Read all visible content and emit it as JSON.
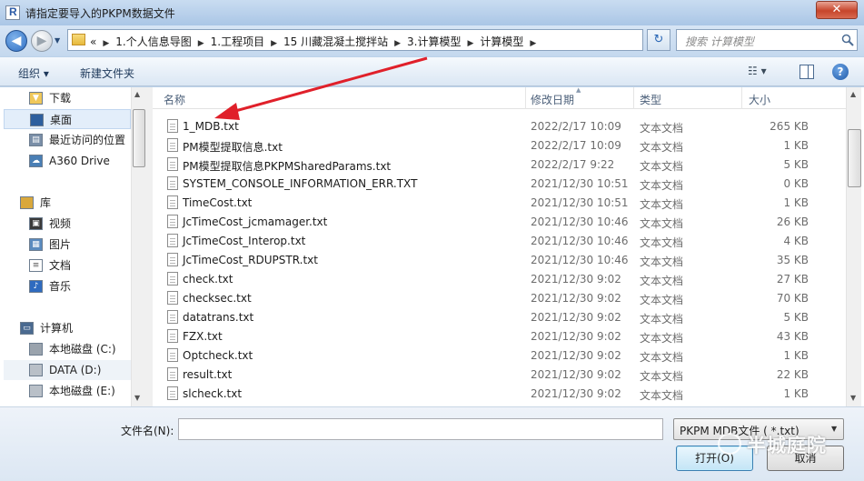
{
  "window": {
    "title": "请指定要导入的PKPM数据文件",
    "close_label": "✕"
  },
  "nav": {
    "back_glyph": "◀",
    "forward_glyph": "▶",
    "breadcrumbs": [
      "«",
      "1.个人信息导图",
      "1.工程项目",
      "15 川藏混凝土搅拌站",
      "3.计算模型",
      "计算模型"
    ],
    "refresh_glyph": "↻",
    "search_placeholder": "搜索 计算模型"
  },
  "toolbar": {
    "organize_label": "组织 ▾",
    "new_folder_label": "新建文件夹",
    "view_label": "☷ ▾",
    "help_label": "?"
  },
  "sidebar": {
    "items": [
      {
        "label": "下载",
        "icon": "download-folder-icon",
        "group": false
      },
      {
        "label": "桌面",
        "icon": "desktop-icon",
        "group": false,
        "selected": true
      },
      {
        "label": "最近访问的位置",
        "icon": "recent-places-icon",
        "group": false
      },
      {
        "label": "A360 Drive",
        "icon": "cloud-drive-icon",
        "group": false
      },
      {
        "label": "库",
        "icon": "library-icon",
        "group": true
      },
      {
        "label": "视频",
        "icon": "video-icon",
        "group": false
      },
      {
        "label": "图片",
        "icon": "picture-icon",
        "group": false
      },
      {
        "label": "文档",
        "icon": "document-icon",
        "group": false
      },
      {
        "label": "音乐",
        "icon": "music-icon",
        "group": false
      },
      {
        "label": "计算机",
        "icon": "computer-icon",
        "group": true
      },
      {
        "label": "本地磁盘 (C:)",
        "icon": "system-drive-icon",
        "group": false
      },
      {
        "label": "DATA (D:)",
        "icon": "drive-icon",
        "group": false,
        "hover": true
      },
      {
        "label": "本地磁盘 (E:)",
        "icon": "drive-icon",
        "group": false
      }
    ]
  },
  "filelist": {
    "columns": {
      "name": "名称",
      "date": "修改日期",
      "type": "类型",
      "size": "大小"
    },
    "rows": [
      {
        "name": "1_MDB.txt",
        "date": "2022/2/17 10:09",
        "type": "文本文档",
        "size": "265 KB"
      },
      {
        "name": "PM模型提取信息.txt",
        "date": "2022/2/17 10:09",
        "type": "文本文档",
        "size": "1 KB"
      },
      {
        "name": "PM模型提取信息PKPMSharedParams.txt",
        "date": "2022/2/17 9:22",
        "type": "文本文档",
        "size": "5 KB"
      },
      {
        "name": "SYSTEM_CONSOLE_INFORMATION_ERR.TXT",
        "date": "2021/12/30 10:51",
        "type": "文本文档",
        "size": "0 KB"
      },
      {
        "name": "TimeCost.txt",
        "date": "2021/12/30 10:51",
        "type": "文本文档",
        "size": "1 KB"
      },
      {
        "name": "JcTimeCost_jcmamager.txt",
        "date": "2021/12/30 10:46",
        "type": "文本文档",
        "size": "26 KB"
      },
      {
        "name": "JcTimeCost_Interop.txt",
        "date": "2021/12/30 10:46",
        "type": "文本文档",
        "size": "4 KB"
      },
      {
        "name": "JcTimeCost_RDUPSTR.txt",
        "date": "2021/12/30 10:46",
        "type": "文本文档",
        "size": "35 KB"
      },
      {
        "name": "check.txt",
        "date": "2021/12/30 9:02",
        "type": "文本文档",
        "size": "27 KB"
      },
      {
        "name": "checksec.txt",
        "date": "2021/12/30 9:02",
        "type": "文本文档",
        "size": "70 KB"
      },
      {
        "name": "datatrans.txt",
        "date": "2021/12/30 9:02",
        "type": "文本文档",
        "size": "5 KB"
      },
      {
        "name": "FZX.txt",
        "date": "2021/12/30 9:02",
        "type": "文本文档",
        "size": "43 KB"
      },
      {
        "name": "Optcheck.txt",
        "date": "2021/12/30 9:02",
        "type": "文本文档",
        "size": "1 KB"
      },
      {
        "name": "result.txt",
        "date": "2021/12/30 9:02",
        "type": "文本文档",
        "size": "22 KB"
      },
      {
        "name": "slcheck.txt",
        "date": "2021/12/30 9:02",
        "type": "文本文档",
        "size": "1 KB"
      }
    ]
  },
  "bottom": {
    "filename_label": "文件名(N):",
    "filename_value": "",
    "filetype_value": "PKPM MDB文件 ( *.txt)",
    "open_label": "打开(O)",
    "cancel_label": "取消"
  },
  "watermark": {
    "text": "半城庭院"
  },
  "colors": {
    "annotation_arrow": "#e0202a",
    "selection": "#e3eefa",
    "title_bar": "#c9dcf1"
  }
}
